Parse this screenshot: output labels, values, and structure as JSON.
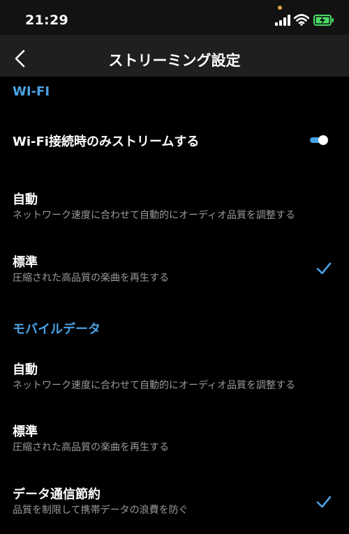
{
  "status_bar": {
    "time": "21:29"
  },
  "header": {
    "title": "ストリーミング設定",
    "back_icon": "chevron-left-icon"
  },
  "sections": {
    "wifi": {
      "header": "WI-FI",
      "toggle_row": {
        "label": "Wi-Fi接続時のみストリームする",
        "toggle_on": true
      },
      "options": [
        {
          "title": "自動",
          "subtitle": "ネットワーク速度に合わせて自動的にオーディオ品質を調整する",
          "selected": false
        },
        {
          "title": "標準",
          "subtitle": "圧縮された高品質の楽曲を再生する",
          "selected": true
        }
      ]
    },
    "mobile": {
      "header": "モバイルデータ",
      "options": [
        {
          "title": "自動",
          "subtitle": "ネットワーク速度に合わせて自動的にオーディオ品質を調整する",
          "selected": false
        },
        {
          "title": "標準",
          "subtitle": "圧縮された高品質の楽曲を再生する",
          "selected": false
        },
        {
          "title": "データ通信節約",
          "subtitle": "品質を制限して携帯データの浪費を防ぐ",
          "selected": true
        }
      ]
    }
  },
  "colors": {
    "accent": "#4aa3e6",
    "background": "#000000",
    "header_background": "#1f1f1f",
    "secondary_text": "#9a9a9a"
  }
}
